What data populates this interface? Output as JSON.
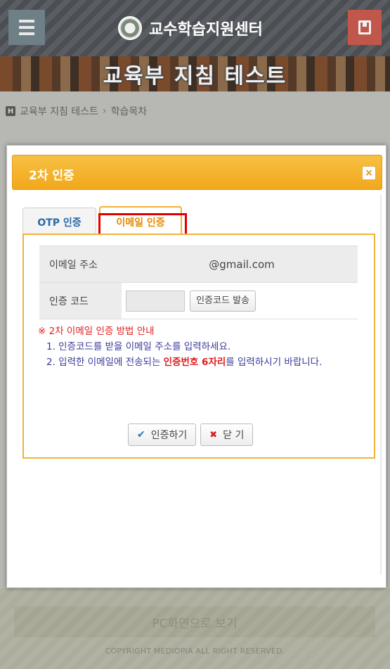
{
  "header": {
    "site_title": "교수학습지원센터",
    "banner_title": "교육부 지침 테스트"
  },
  "breadcrumb": {
    "icon_text": "H",
    "course": "교육부 지침 테스트",
    "separator": "›",
    "current": "학습목차"
  },
  "modal": {
    "title": "2차 인증",
    "close_icon": "×",
    "tabs": [
      {
        "label": "OTP 인증"
      },
      {
        "label": "이메일 인증"
      }
    ],
    "form": {
      "email_label": "이메일 주소",
      "email_value": "@gmail.com",
      "code_label": "인증 코드",
      "code_value": "",
      "send_button": "인증코드 발송"
    },
    "guide": {
      "title": "※ 2차 이메일 인증 방법 안내",
      "line1": "1. 인증코드를 받을 이메일 주소를 입력하세요.",
      "line2_prefix": "2. 입력한 이메일에 전송되는 ",
      "line2_highlight": "인증번호 6자리",
      "line2_suffix": "를 입력하시기 바랍니다."
    },
    "buttons": {
      "verify": "인증하기",
      "close": "닫 기"
    }
  },
  "footer": {
    "pc_view": "PC화면으로 보기",
    "copyright": "COPYRIGHT MEDIOPIA ALL RIGHT RESERVED."
  },
  "colors": {
    "modal_accent": "#f2a81b",
    "highlight": "#e00000",
    "otp_tab": "#2a6aa8",
    "email_tab": "#e68a00"
  },
  "icons": {
    "menu": "menu-icon",
    "logo": "logo-icon",
    "book": "book-icon",
    "verify": "check-icon",
    "close": "x-icon"
  }
}
